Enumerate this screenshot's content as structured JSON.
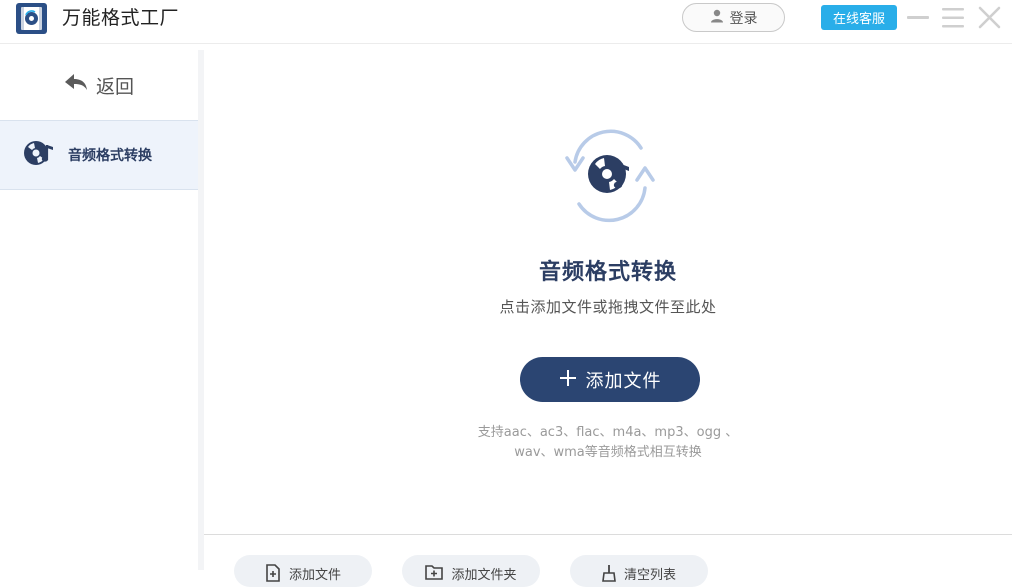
{
  "app": {
    "title": "万能格式工厂",
    "login_label": "登录",
    "service_label": "在线客服"
  },
  "sidebar": {
    "back_label": "返回",
    "items": [
      {
        "label": "音频格式转换",
        "icon": "audio-disc-icon",
        "active": true
      }
    ]
  },
  "main": {
    "title": "音频格式转换",
    "subtitle": "点击添加文件或拖拽文件至此处",
    "add_label": "添加文件",
    "support_line1": "支持aac、ac3、flac、m4a、mp3、ogg 、",
    "support_line2": "wav、wma等音频格式相互转换"
  },
  "bottom_bar": {
    "buttons": [
      {
        "label": "添加文件",
        "icon": "file-add-icon"
      },
      {
        "label": "添加文件夹",
        "icon": "folder-add-icon"
      },
      {
        "label": "清空列表",
        "icon": "broom-icon"
      }
    ]
  },
  "colors": {
    "primary": "#2b4572",
    "accent": "#29aee9",
    "sidebar_active": "#eef3fb",
    "title_text": "#2c3e63"
  }
}
